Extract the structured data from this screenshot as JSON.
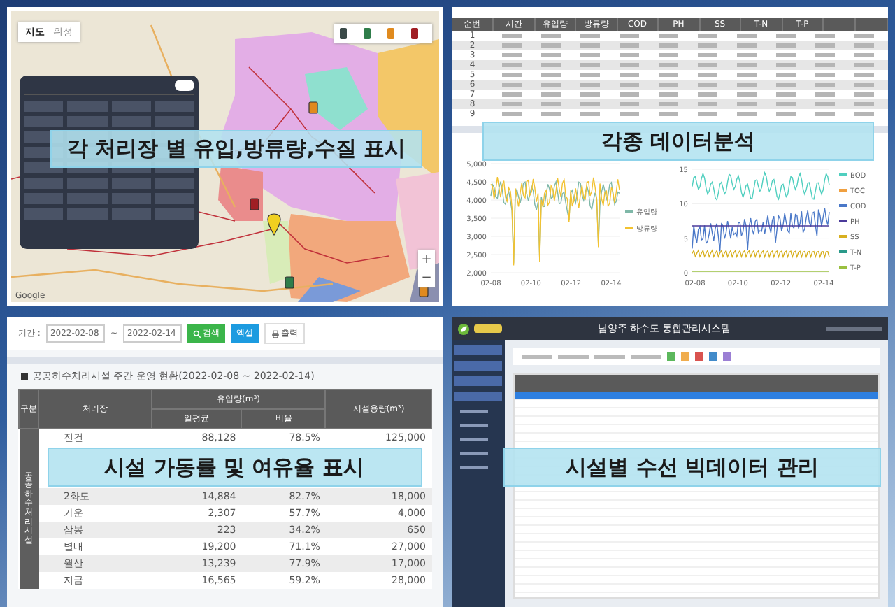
{
  "map_panel": {
    "map_type_tabs": [
      {
        "label": "지도",
        "selected": true
      },
      {
        "label": "위성",
        "selected": false
      }
    ],
    "legend": [
      {
        "color": "#3a4a48"
      },
      {
        "color": "#2f7d4a"
      },
      {
        "color": "#e08a1e"
      },
      {
        "color": "#a01e24"
      }
    ],
    "zoom_controls": [
      "+",
      "−"
    ],
    "attribution": "Google",
    "caption": "각 처리장 별 유입,방류량,수질 표시"
  },
  "data_panel": {
    "table": {
      "columns": [
        "순번",
        "시간",
        "유입량",
        "방류량",
        "COD",
        "PH",
        "SS",
        "T-N",
        "T-P"
      ],
      "row_numbers": [
        "1",
        "2",
        "3",
        "4",
        "5",
        "6",
        "7",
        "8",
        "9"
      ]
    },
    "caption": "각종 데이터분석",
    "flow_chart": {
      "yticks": [
        "5,000",
        "4,500",
        "4,000",
        "3,500",
        "3,000",
        "2,500",
        "2,000"
      ],
      "xticks": [
        "02-08",
        "02-10",
        "02-12",
        "02-14"
      ],
      "legend": [
        {
          "label": "유입량",
          "color": "#7fb8a8"
        },
        {
          "label": "방류량",
          "color": "#f2c230"
        }
      ]
    },
    "quality_chart": {
      "yticks": [
        "15",
        "10",
        "5",
        "0"
      ],
      "xticks": [
        "02-08",
        "02-10",
        "02-12",
        "02-14"
      ],
      "legend": [
        {
          "label": "BOD",
          "color": "#4fcfbf"
        },
        {
          "label": "TOC",
          "color": "#f0a040"
        },
        {
          "label": "COD",
          "color": "#4a78c8"
        },
        {
          "label": "PH",
          "color": "#4b3a9a"
        },
        {
          "label": "SS",
          "color": "#d8b020"
        },
        {
          "label": "T-N",
          "color": "#2a9a8a"
        },
        {
          "label": "T-P",
          "color": "#9ac040"
        }
      ]
    }
  },
  "capacity_panel": {
    "period_label": "기간 :",
    "date_from": "2022-02-08",
    "separator": "~",
    "date_to": "2022-02-14",
    "buttons": [
      {
        "label": "검색",
        "kind": "search"
      },
      {
        "label": "엑셀",
        "kind": "excel"
      },
      {
        "label": "출력",
        "kind": "print"
      }
    ],
    "title": "공공하수처리시설 주간 운영 현황(2022-02-08 ~ 2022-02-14)",
    "table": {
      "group_header": "구분",
      "name_header": "처리장",
      "inflow_header": "유입량(m³)",
      "sub_headers": [
        "일평균",
        "비율"
      ],
      "capacity_header": "시설용량(m³)",
      "group_label": "공공하수처리시설",
      "rows": [
        {
          "name": "진건",
          "daily_avg": "88,128",
          "ratio": "78.5%",
          "capacity": "125,000"
        },
        {
          "name": "2화도",
          "daily_avg": "14,884",
          "ratio": "82.7%",
          "capacity": "18,000"
        },
        {
          "name": "가운",
          "daily_avg": "2,307",
          "ratio": "57.7%",
          "capacity": "4,000"
        },
        {
          "name": "삼봉",
          "daily_avg": "223",
          "ratio": "34.2%",
          "capacity": "650"
        },
        {
          "name": "별내",
          "daily_avg": "19,200",
          "ratio": "71.1%",
          "capacity": "27,000"
        },
        {
          "name": "월산",
          "daily_avg": "13,239",
          "ratio": "77.9%",
          "capacity": "17,000"
        },
        {
          "name": "지금",
          "daily_avg": "16,565",
          "ratio": "59.2%",
          "capacity": "28,000"
        }
      ]
    },
    "caption": "시설 가동률 및 여유율 표시"
  },
  "repair_panel": {
    "system_title": "남양주 하수도 통합관리시스템",
    "caption": "시설별 수선 빅데이터 관리"
  }
}
